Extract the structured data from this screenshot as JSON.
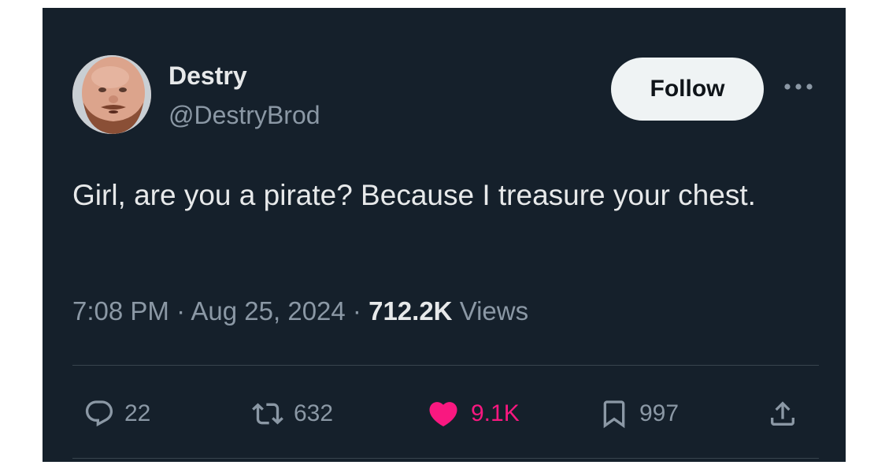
{
  "author": {
    "display_name": "Destry",
    "handle": "@DestryBrod"
  },
  "follow_label": "Follow",
  "tweet": {
    "text": "Girl, are you a pirate? Because I treasure your chest."
  },
  "meta": {
    "time": "7:08 PM",
    "separator": " · ",
    "date": "Aug 25, 2024",
    "views_count": "712.2K",
    "views_label": "Views"
  },
  "actions": {
    "replies": "22",
    "reposts": "632",
    "likes": "9.1K",
    "bookmarks": "997"
  },
  "colors": {
    "background": "#15202b",
    "like": "#f91880",
    "muted": "#8b98a5",
    "text": "#e7e9ea"
  },
  "icons": [
    "reply-icon",
    "repost-icon",
    "heart-icon",
    "bookmark-icon",
    "share-icon",
    "more-icon"
  ]
}
